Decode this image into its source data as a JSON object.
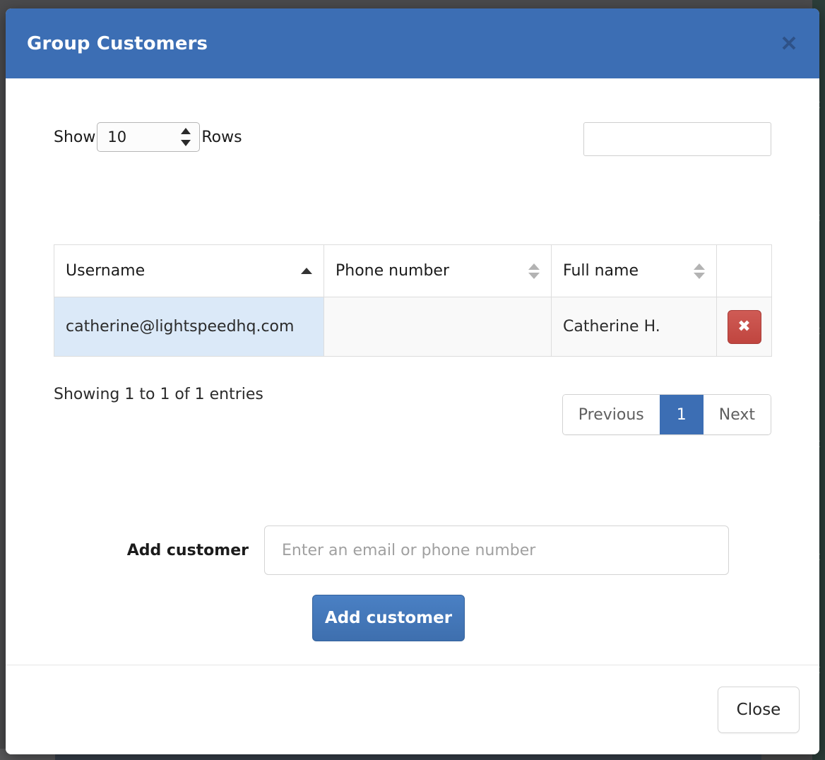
{
  "modal": {
    "title": "Group Customers",
    "close_icon": "close-x-icon"
  },
  "table_controls": {
    "show_label": "Show",
    "rows_label": "Rows",
    "page_length_value": "10",
    "search_value": "",
    "search_placeholder": ""
  },
  "table": {
    "columns": [
      {
        "label": "Username",
        "sort": "asc"
      },
      {
        "label": "Phone number",
        "sort": "none"
      },
      {
        "label": "Full name",
        "sort": "none"
      },
      {
        "label": "",
        "sort": "none"
      }
    ],
    "rows": [
      {
        "username": "catherine@lightspeedhq.com",
        "phone_number": "",
        "full_name": "Catherine H.",
        "delete_label": "✖"
      }
    ],
    "info": "Showing 1 to 1 of 1 entries"
  },
  "pagination": {
    "previous_label": "Previous",
    "pages": [
      "1"
    ],
    "active_page": "1",
    "next_label": "Next"
  },
  "add_customer": {
    "label": "Add customer",
    "input_value": "",
    "input_placeholder": "Enter an email or phone number",
    "button_label": "Add customer"
  },
  "footer": {
    "close_label": "Close"
  },
  "colors": {
    "header_blue": "#3c6eb4",
    "accent_blue": "#3c6eb4",
    "danger_red": "#c0453f",
    "sorted_cell_blue": "#dbe9f8",
    "row_grey": "#f9f9f9",
    "backdrop": "#4b4b4d"
  }
}
